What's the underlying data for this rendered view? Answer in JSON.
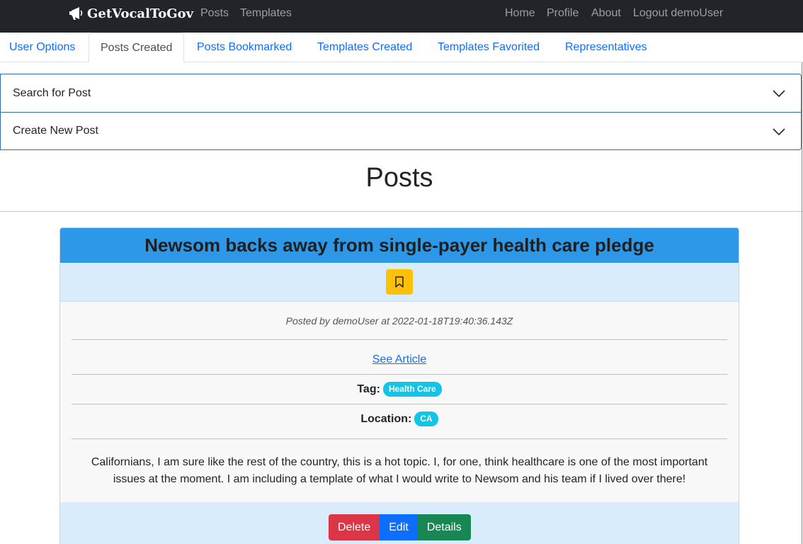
{
  "navbar": {
    "brand": "GetVocalToGov",
    "brand_icon": "megaphone-icon",
    "left_links": [
      "Posts",
      "Templates"
    ],
    "right_links": [
      "Home",
      "Profile",
      "About",
      "Logout demoUser"
    ]
  },
  "tabs": [
    {
      "label": "User Options",
      "active": false
    },
    {
      "label": "Posts Created",
      "active": true
    },
    {
      "label": "Posts Bookmarked",
      "active": false
    },
    {
      "label": "Templates Created",
      "active": false
    },
    {
      "label": "Templates Favorited",
      "active": false
    },
    {
      "label": "Representatives",
      "active": false
    }
  ],
  "accordion": {
    "items": [
      "Search for Post",
      "Create New Post"
    ]
  },
  "page_title": "Posts",
  "post": {
    "title": "Newsom backs away from single-payer health care pledge",
    "meta": "Posted by demoUser at 2022-01-18T19:40:36.143Z",
    "article_link": "See Article",
    "tag_label": "Tag:",
    "tag_value": "Health Care",
    "location_label": "Location:",
    "location_value": "CA",
    "body": "Californians, I am sure like the rest of the country, this is a hot topic. I, for one, think healthcare is one of the most important issues at the moment. I am including a template of what I would write to Newsom and his team if I lived over there!",
    "buttons": {
      "delete": "Delete",
      "edit": "Edit",
      "details": "Details"
    }
  },
  "colors": {
    "navbar_bg": "#212529",
    "card_header": "#2d97e8",
    "bookmark": "#ffc107",
    "badge": "#12c5e8",
    "delete": "#dc3545",
    "edit": "#0d6efd",
    "details": "#198754"
  }
}
